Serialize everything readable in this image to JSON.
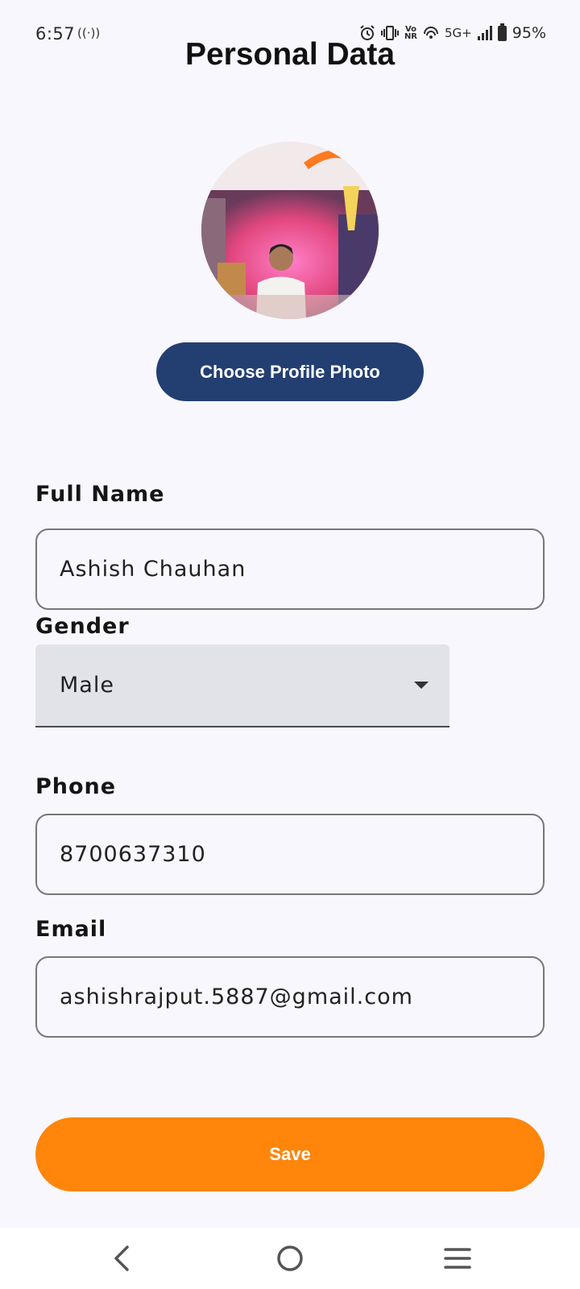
{
  "status_bar": {
    "time": "6:57",
    "network": "5G+",
    "battery": "95%",
    "icons": [
      "hotspot-icon",
      "alarm-icon",
      "vibrate-icon",
      "vonr-icon",
      "wifi-calling-icon",
      "signal-icon",
      "battery-icon"
    ]
  },
  "page": {
    "title": "Personal Data"
  },
  "profile": {
    "choose_photo_label": "Choose Profile Photo"
  },
  "form": {
    "full_name": {
      "label": "Full Name",
      "value": "Ashish Chauhan"
    },
    "gender": {
      "label": "Gender",
      "value": "Male"
    },
    "phone": {
      "label": "Phone",
      "value": "8700637310"
    },
    "email": {
      "label": "Email",
      "value": "ashishrajput.5887@gmail.com"
    }
  },
  "actions": {
    "save_label": "Save"
  },
  "colors": {
    "background": "#f8f7fd",
    "primary_button": "#233f72",
    "accent": "#ff850b",
    "dropdown_fill": "#e2e2e9"
  },
  "nav": {
    "icons": [
      "back-icon",
      "home-icon",
      "recents-icon"
    ]
  }
}
